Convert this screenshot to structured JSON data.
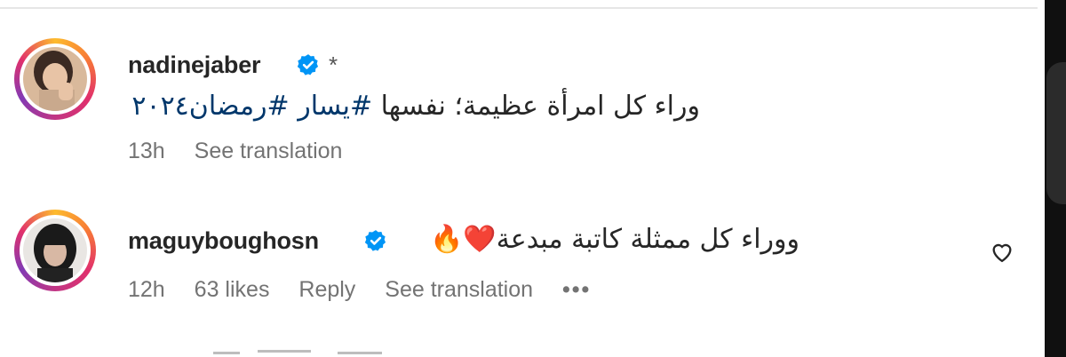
{
  "comments": [
    {
      "username": "nadinejaber",
      "suffix": "*",
      "text_plain": "وراء كل امرأة عظيمة؛ نفسها ",
      "hashtags": "#يسار #رمضان٢٠٢٤",
      "time": "13h",
      "see_translation": "See translation"
    },
    {
      "username": "maguyboughosn",
      "text": "ووراء كل ممثلة كاتبة مبدعة",
      "emoji": "❤️🔥",
      "time": "12h",
      "likes": "63 likes",
      "reply": "Reply",
      "see_translation": "See translation",
      "more": "•••"
    }
  ],
  "icons": {
    "verified": "verified-badge-icon",
    "like": "heart-outline-icon"
  },
  "colors": {
    "verified_blue": "#0095f6",
    "hashtag": "#00376b",
    "meta_gray": "#737373"
  }
}
